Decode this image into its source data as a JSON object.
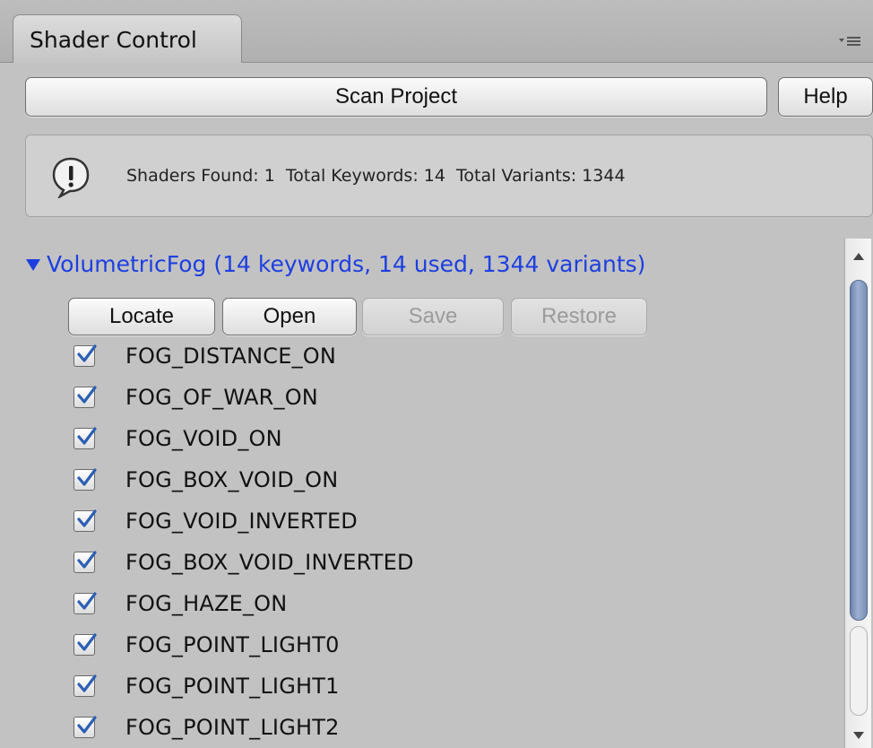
{
  "window": {
    "tab_title": "Shader Control",
    "tab_menu_icon": "tab-options-icon"
  },
  "toolbar": {
    "scan_label": "Scan Project",
    "help_label": "Help"
  },
  "info": {
    "icon": "exclamation-circle-icon",
    "text": "Shaders Found: 1  Total Keywords: 14  Total Variants: 1344"
  },
  "shader": {
    "expanded": true,
    "title": "VolumetricFog (14 keywords, 14 used, 1344 variants)",
    "title_color": "#1d3fe0",
    "actions": {
      "locate": "Locate",
      "open": "Open",
      "save": "Save",
      "restore": "Restore"
    },
    "keywords": [
      {
        "label": "FOG_DISTANCE_ON",
        "checked": true
      },
      {
        "label": "FOG_OF_WAR_ON",
        "checked": true
      },
      {
        "label": "FOG_VOID_ON",
        "checked": true
      },
      {
        "label": "FOG_BOX_VOID_ON",
        "checked": true
      },
      {
        "label": "FOG_VOID_INVERTED",
        "checked": true
      },
      {
        "label": "FOG_BOX_VOID_INVERTED",
        "checked": true
      },
      {
        "label": "FOG_HAZE_ON",
        "checked": true
      },
      {
        "label": "FOG_POINT_LIGHT0",
        "checked": true
      },
      {
        "label": "FOG_POINT_LIGHT1",
        "checked": true
      },
      {
        "label": "FOG_POINT_LIGHT2",
        "checked": true
      }
    ]
  },
  "colors": {
    "panel_bg": "#c2c2c2",
    "check_mark": "#2b5fb3",
    "scroll_thumb": "#7f95bd"
  }
}
